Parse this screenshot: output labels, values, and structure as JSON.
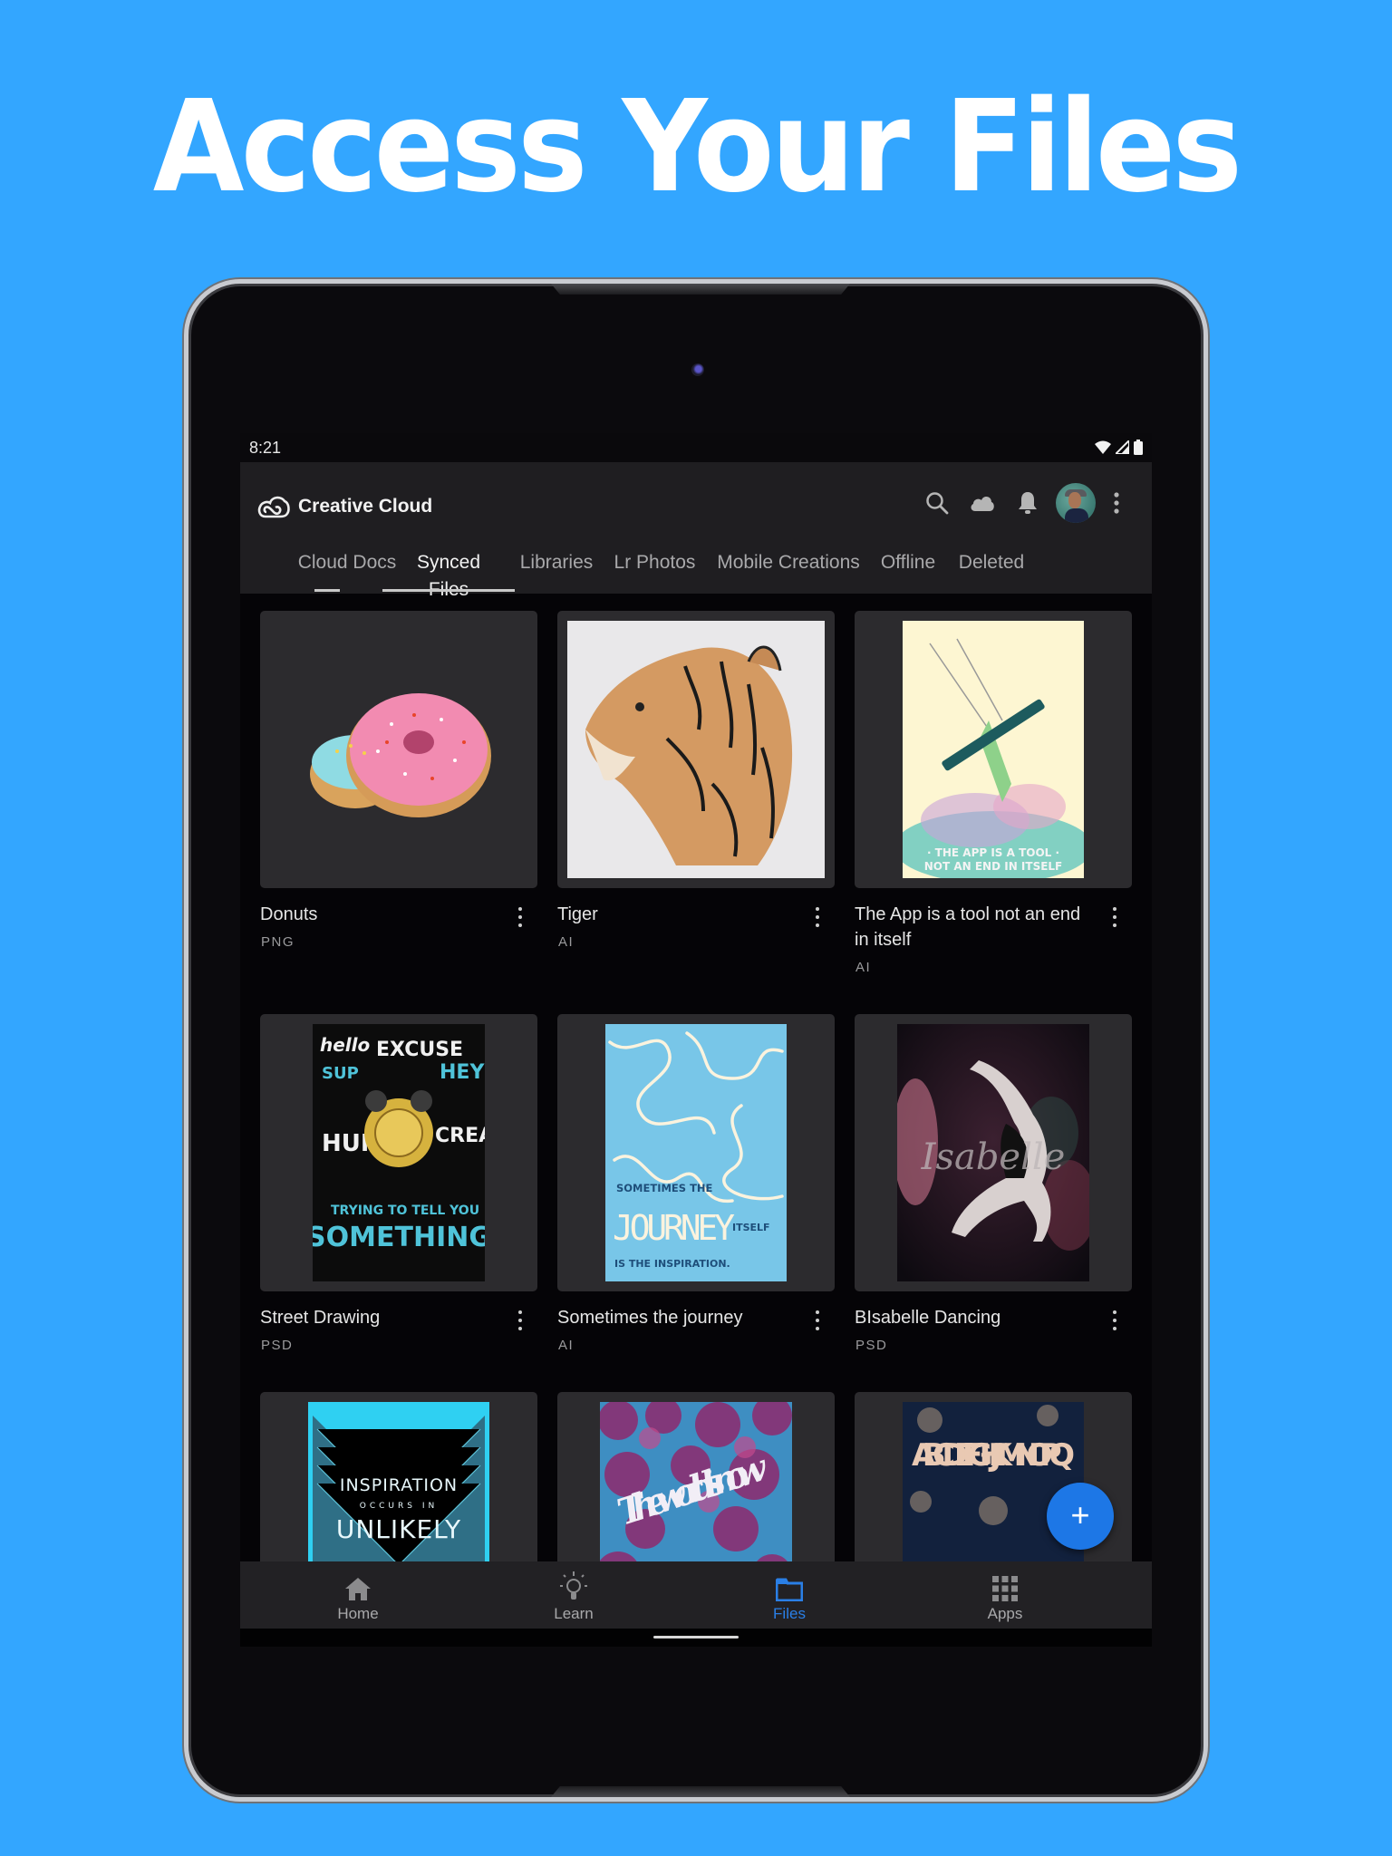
{
  "headline": "Access Your Files",
  "status_bar": {
    "time": "8:21",
    "icons": [
      "wifi-icon",
      "cellular-signal-icon",
      "battery-icon"
    ]
  },
  "app_bar": {
    "app_name": "Creative Cloud",
    "actions": [
      "search-icon",
      "cloud-icon",
      "notification-bell-icon",
      "user-avatar",
      "more-vertical-icon"
    ]
  },
  "tabs": [
    {
      "label": "Cloud Docs",
      "active": false
    },
    {
      "label": "Synced Files",
      "active": true
    },
    {
      "label": "Libraries",
      "active": false
    },
    {
      "label": "Lr Photos",
      "active": false
    },
    {
      "label": "Mobile Creations",
      "active": false
    },
    {
      "label": "Offline",
      "active": false
    },
    {
      "label": "Deleted",
      "active": false
    }
  ],
  "files": [
    {
      "name": "Donuts",
      "type": "PNG",
      "thumbnail": "pink and blue glazed donuts"
    },
    {
      "name": "Tiger",
      "type": "AI",
      "thumbnail": "watercolor tiger head"
    },
    {
      "name": "The App is a tool not an end in itself",
      "type": "AI",
      "thumbnail": "poster: THE APP IS A TOOL NOT AN END IN ITSELF"
    },
    {
      "name": "Street Drawing",
      "type": "PSD",
      "thumbnail": "lettering poster: SOMETHING"
    },
    {
      "name": "Sometimes the journey",
      "type": "AI",
      "thumbnail": "poster: SOMETIMES THE JOURNEY ITSELF IS THE INSPIRATION."
    },
    {
      "name": "BIsabelle Dancing",
      "type": "PSD",
      "thumbnail": "dancer photo with Isabelle script"
    },
    {
      "name": "",
      "type": "",
      "thumbnail": "poster: INSPIRATION OCCURS IN UNLIKELY"
    },
    {
      "name": "",
      "type": "",
      "thumbnail": "poster: The world is now"
    },
    {
      "name": "",
      "type": "",
      "thumbnail": "floral alphabet poster"
    }
  ],
  "thumb_text": {
    "app_tool_1": "· THE APP IS A TOOL ·",
    "app_tool_2": "NOT AN END IN ITSELF",
    "journey_1": "SOMETIMES THE",
    "journey_2": "JOURNEY",
    "journey_3": "ITSELF",
    "journey_4": "IS THE INSPIRATION.",
    "street_1": "SOMETHING",
    "isabelle": "Isabelle",
    "inspiration_1": "INSPIRATION",
    "inspiration_2": "OCCURS IN",
    "inspiration_3": "UNLIKELY",
    "world": "The world is now",
    "alphabet": "ABCDEF GHIJK MNOPQ"
  },
  "fab": {
    "label": "+",
    "icon": "plus-icon"
  },
  "bottom_nav": [
    {
      "label": "Home",
      "icon": "home-icon",
      "active": false
    },
    {
      "label": "Learn",
      "icon": "lightbulb-icon",
      "active": false
    },
    {
      "label": "Files",
      "icon": "folder-icon",
      "active": true
    },
    {
      "label": "Apps",
      "icon": "apps-grid-icon",
      "active": false
    }
  ],
  "colors": {
    "page_background": "#33a6ff",
    "accent": "#1d77e6",
    "app_bar": "#1f1e21",
    "card": "#2c2b2e"
  }
}
